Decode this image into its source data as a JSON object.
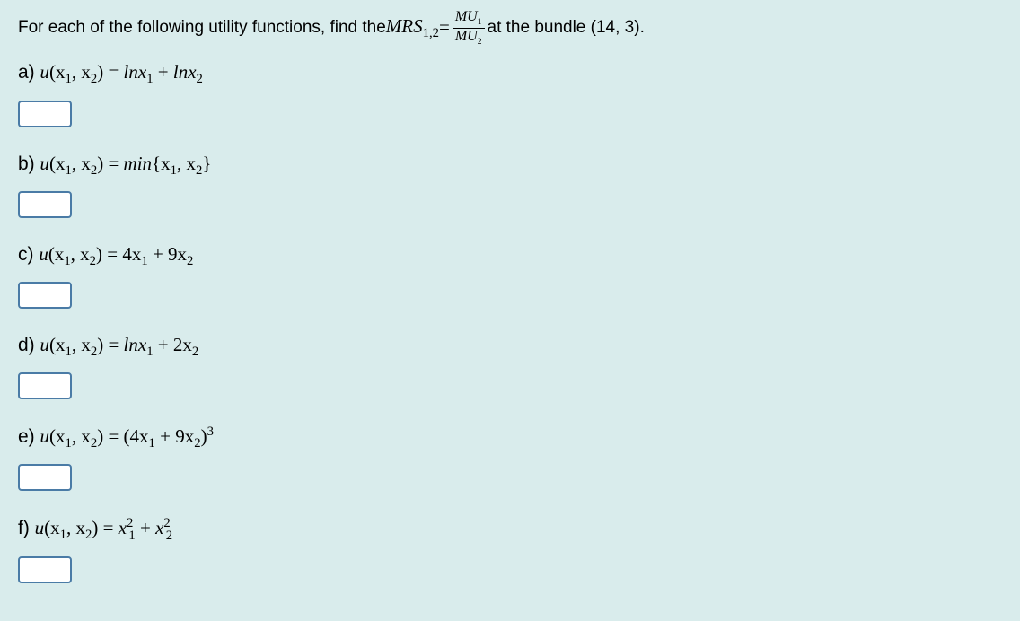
{
  "intro": {
    "prefix": "For each of the following utility functions, find the ",
    "mrs_label": "MRS",
    "mrs_sub": "1,2",
    "equals": " = ",
    "frac_num_mu": "MU",
    "frac_num_sub": "1",
    "frac_den_mu": "MU",
    "frac_den_sub": "2",
    "suffix": " at the bundle (14, 3)."
  },
  "questions": {
    "a": {
      "label": "a) ",
      "u_prefix": "u",
      "args": "(x",
      "sub1": "1",
      "comma": ", x",
      "sub2": "2",
      "close": ") = ",
      "expr_1": "lnx",
      "expr_sub1": "1",
      "expr_plus": " + ",
      "expr_2": "lnx",
      "expr_sub2": "2"
    },
    "b": {
      "label": "b) ",
      "u_prefix": "u",
      "args": "(x",
      "sub1": "1",
      "comma": ", x",
      "sub2": "2",
      "close": ") = ",
      "expr_min": "min",
      "expr_open": "{x",
      "expr_sub1": "1",
      "expr_comma": ", x",
      "expr_sub2": "2",
      "expr_close": "}"
    },
    "c": {
      "label": "c) ",
      "u_prefix": "u",
      "args": "(x",
      "sub1": "1",
      "comma": ", x",
      "sub2": "2",
      "close": ") = ",
      "expr_1": "4x",
      "expr_sub1": "1",
      "expr_plus": " + 9x",
      "expr_sub2": "2"
    },
    "d": {
      "label": "d) ",
      "u_prefix": "u",
      "args": "(x",
      "sub1": "1",
      "comma": ", x",
      "sub2": "2",
      "close": ") = ",
      "expr_1": "lnx",
      "expr_sub1": "1",
      "expr_plus": " + 2x",
      "expr_sub2": "2"
    },
    "e": {
      "label": "e) ",
      "u_prefix": "u",
      "args": "(x",
      "sub1": "1",
      "comma": ", x",
      "sub2": "2",
      "close": ") = ",
      "expr_open": "(4x",
      "expr_sub1": "1",
      "expr_plus": " + 9x",
      "expr_sub2": "2",
      "expr_close": ")",
      "expr_sup": "3"
    },
    "f": {
      "label": "f) ",
      "u_prefix": "u",
      "args": "(x",
      "sub1": "1",
      "comma": ", x",
      "sub2": "2",
      "close": ") = ",
      "expr_x1": "x",
      "expr_sup1": "2",
      "expr_sub1": "1",
      "expr_plus": " + ",
      "expr_x2": "x",
      "expr_sup2": "2",
      "expr_sub2": "2"
    }
  }
}
